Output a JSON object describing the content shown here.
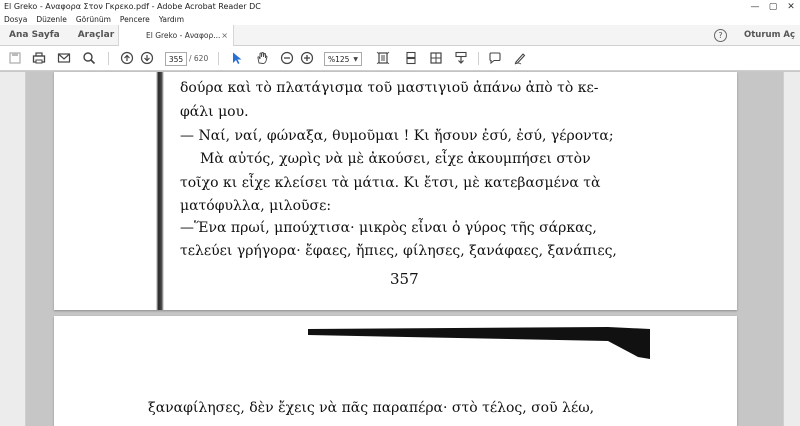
{
  "window": {
    "title": "El Greko - Αναφορα Στον Γκρεκο.pdf - Adobe Acrobat Reader DC",
    "min_symbol": "—",
    "max_symbol": "▢",
    "close_symbol": "✕"
  },
  "menu": [
    "Dosya",
    "Düzenle",
    "Görünüm",
    "Pencere",
    "Yardım"
  ],
  "tabs": {
    "home": "Ana Sayfa",
    "tools": "Araçlar",
    "document": "El Greko - Αναφορ...",
    "close": "×"
  },
  "header": {
    "help": "?",
    "signin": "Oturum Aç"
  },
  "toolbar": {
    "page_current": "355",
    "page_total": "/ 620",
    "zoom": "%125",
    "zoom_arrow": "▼",
    "icons": [
      "save-icon",
      "print-icon",
      "email-icon",
      "search-icon",
      "prev-page-icon",
      "next-page-icon",
      "select-cursor-icon",
      "hand-icon",
      "zoom-out-icon",
      "zoom-in-icon",
      "fit-page-icon",
      "scroll-icon",
      "page-view-icon",
      "save-down-icon",
      "comment-icon",
      "sign-icon"
    ]
  },
  "document": {
    "page1_lines": [
      "δούρα καὶ τὸ πλατάγισμα τοῦ μαστιγιοῦ ἀπάνω ἀπὸ τὸ κε-",
      "φάλι μου.",
      "— Ναί, ναί, φώναξα, θυμοῦμαι ! Κι ἤσουν ἐσύ, ἐσύ, γέροντα;",
      "Μὰ αὐτός, χωρὶς νὰ μὲ ἀκούσει, εἶχε ἀκουμπήσει στὸν",
      "τοῖχο κι εἶχε κλείσει τὰ μάτια. Κι ἔτσι, μὲ κατεβασμένα τὰ",
      "ματόφυλλα, μιλοῦσε:",
      "—Ἕνα πρωί, μπούχτισα· μικρὸς εἶναι ὁ γύρος τῆς σάρκας,",
      "τελεύει γρήγορα· ἔφαες, ἤπιες, φίλησες, ξανάφαες, ξανάπιες,"
    ],
    "page1_number": "357",
    "page2_lines": [
      "ξαναφίλησες, δὲν ἔχεις νὰ πᾶς παραπέρα· στὸ τέλος, σοῦ λέω,"
    ]
  }
}
